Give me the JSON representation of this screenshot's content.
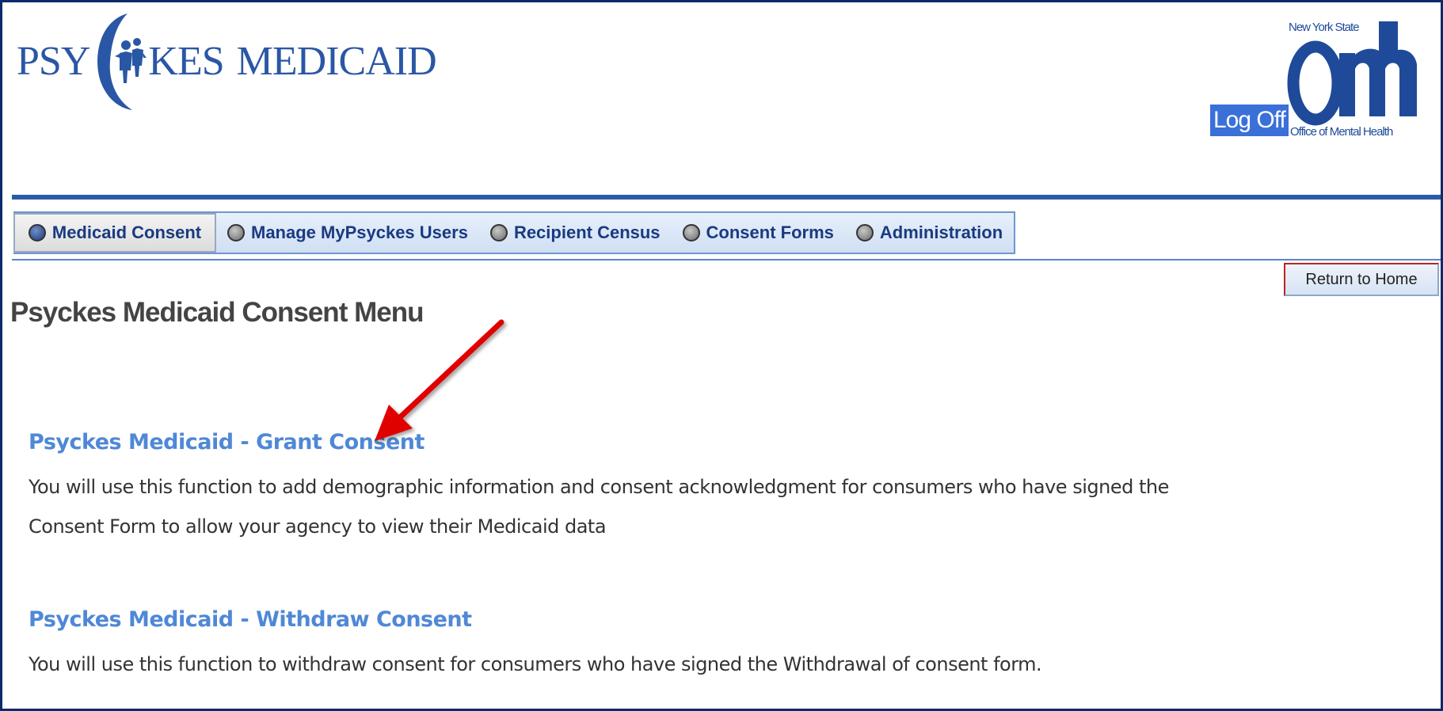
{
  "header": {
    "logo_left": "PSY",
    "logo_right": "KES",
    "logo_suffix": "MEDICAID",
    "logoff_label": "Log Off",
    "agency": {
      "state": "New York State",
      "name": "Office of Mental Health"
    }
  },
  "nav": {
    "tabs": [
      {
        "label": "Medicaid Consent",
        "active": true
      },
      {
        "label": "Manage MyPsyckes Users",
        "active": false
      },
      {
        "label": "Recipient Census",
        "active": false
      },
      {
        "label": "Consent Forms",
        "active": false
      },
      {
        "label": "Administration",
        "active": false
      }
    ]
  },
  "return_label": "Return to Home",
  "page_title": "Psyckes Medicaid Consent Menu",
  "sections": [
    {
      "link": "Psyckes Medicaid - Grant Consent",
      "description": "You will use this function to add demographic information and consent acknowledgment for consumers who have signed the Consent Form  to allow your agency to view their Medicaid data"
    },
    {
      "link": "Psyckes Medicaid - Withdraw Consent",
      "description": "You will use this function to withdraw consent for consumers who have signed the Withdrawal of consent form."
    }
  ],
  "colors": {
    "frame_border": "#0d2a6b",
    "nav_rule": "#2a5ba8",
    "link": "#4f88d6",
    "logoff_bg": "#3a70d8",
    "arrow": "#e00000"
  }
}
